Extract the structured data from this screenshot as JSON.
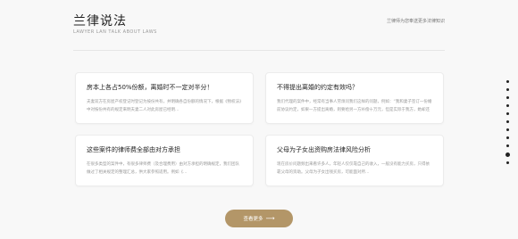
{
  "header": {
    "title": "兰律说法",
    "subtitle": "LAWYER LAN TALK ABOUT LAWS",
    "right_text": "兰律师为您奉送更多法律知识"
  },
  "cards": [
    {
      "title": "房本上各占50%份额，离婚时不一定对半分！",
      "text": "夫妻双方在房屋产权登记时登记为按份共有，并明确各自份额的情况下，根据《物权法》中对按份共有的规定来明夫妻二人对此房屋已经明…"
    },
    {
      "title": "不得提出离婚的约定有效吗？",
      "text": "我们代理的案件中，经常有当事人劳烦问我们这样的问题，例如：“我和妻子签订一份婚前协议约定，如果一方提出离婚，则要给另一方补偿十万元，但是实际于我方，她却还不…"
    },
    {
      "title": "这些案件的律师费全部由对方承担",
      "text": "在很多类型的案件中，有很多律师费（及合理费用）由对方承担的明确规定，我们团队做过了相关规定的整理汇总，供大家参照适用。例如《…"
    },
    {
      "title": "父母为子女出资购房法律风险分析",
      "text": "现在房价问题频出来看许多人，年轻人仅仅靠自己的收入，一般没有能力买房，只得依靠父母的资助。父母为子女出钱买房，可能面对所…"
    }
  ],
  "more_button": {
    "label": "查看更多",
    "arrow": "⟶"
  },
  "page_dots": {
    "count": 11,
    "active_index": 9
  }
}
